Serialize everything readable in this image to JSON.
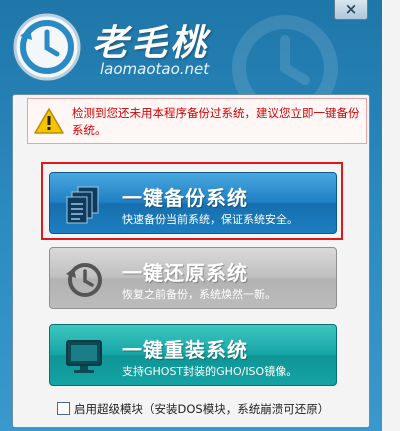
{
  "window": {
    "close_glyph": "×",
    "brand_name": "老毛桃",
    "domain": "laomaotao.net"
  },
  "warning": {
    "text": "检测到您还未用本程序备份过系统，建议您立即一键备份系统。"
  },
  "buttons": [
    {
      "title": "一键备份系统",
      "subtitle": "快速备份当前系统，保证系统安全。",
      "icon": "document-stack-icon"
    },
    {
      "title": "一键还原系统",
      "subtitle": "恢复之前备份，系统焕然一新。",
      "icon": "restore-clock-icon"
    },
    {
      "title": "一键重装系统",
      "subtitle": "支持GHOST封装的GHO/ISO镜像。",
      "icon": "monitor-icon"
    }
  ],
  "option": {
    "label": "启用超级模块（安装DOS模块，系统崩溃可还原）",
    "checked": false
  },
  "colors": {
    "header": "#2a89bf",
    "backup_button": "#1f80c4",
    "restore_button": "#c0c0c0",
    "reinstall_button": "#16a6a6",
    "warning_text": "#d60000",
    "highlight": "#e01818"
  }
}
